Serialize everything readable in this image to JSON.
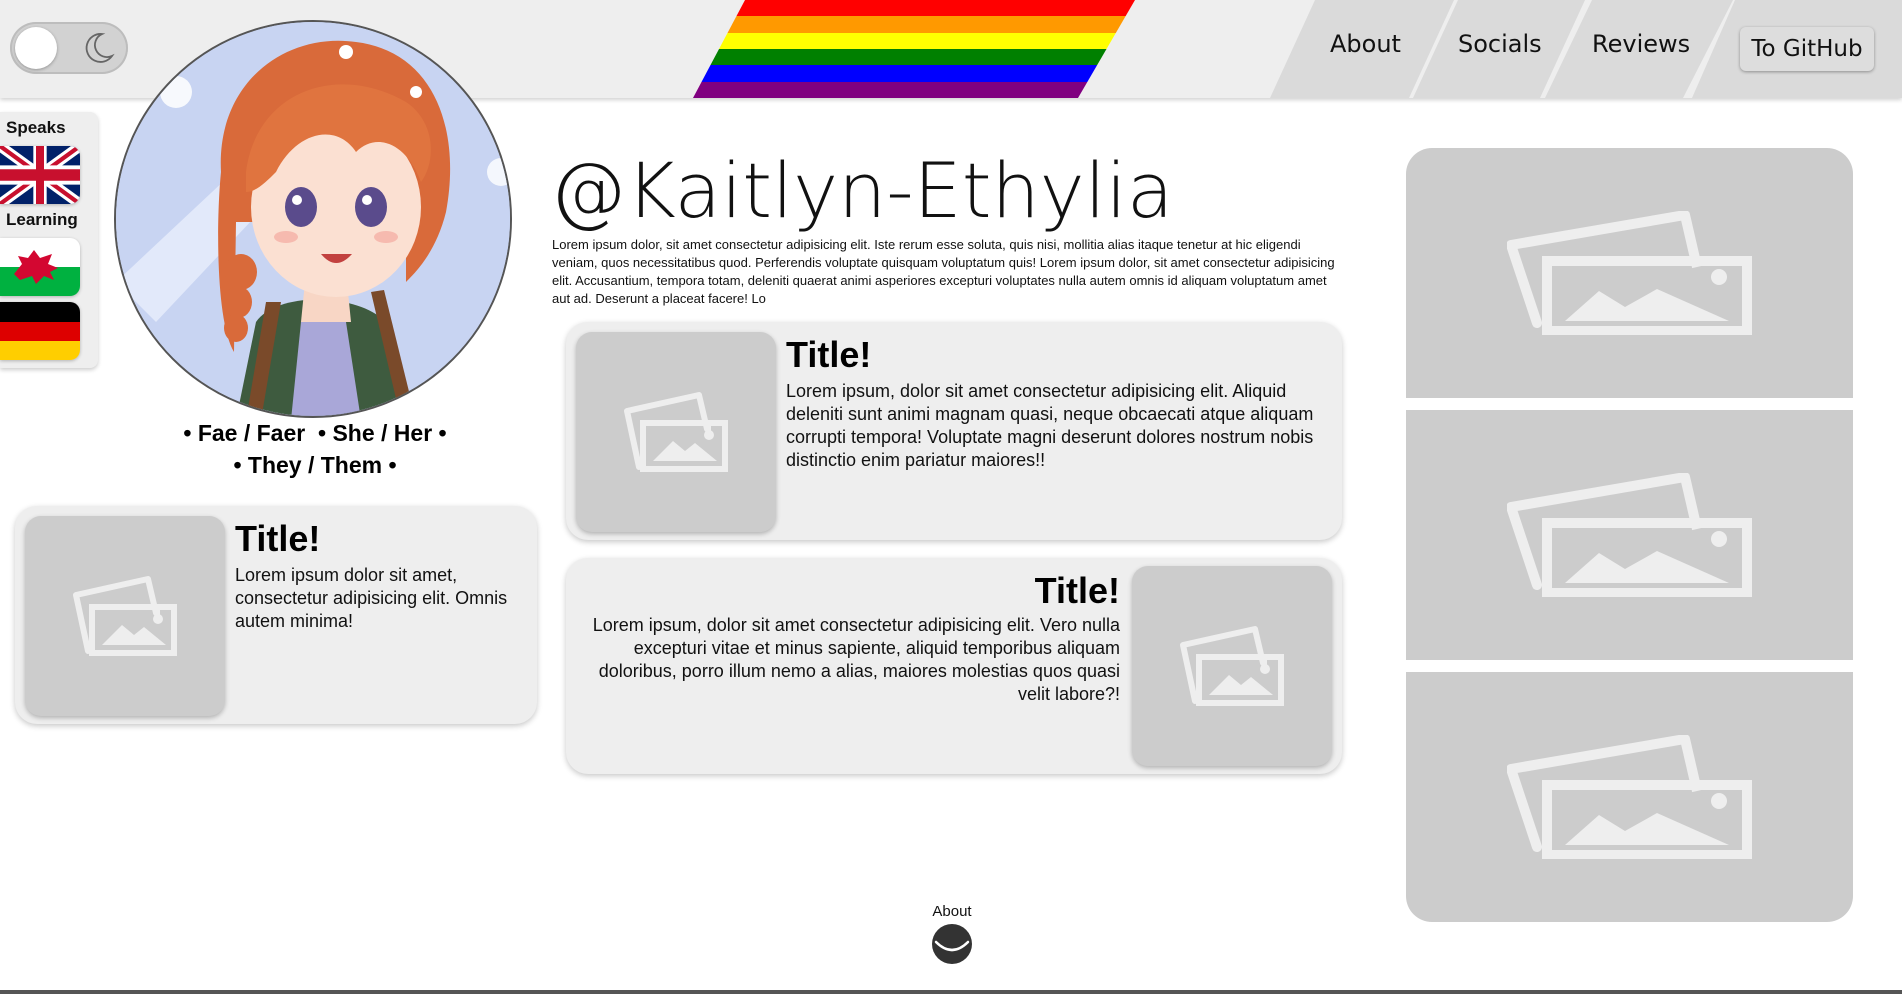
{
  "header": {
    "theme_toggle": {
      "state": "light",
      "icon": "moon-icon"
    },
    "pride_banner": {
      "colors": [
        "#ff0000",
        "#ff9900",
        "#ffff00",
        "#008000",
        "#0000ff",
        "#800080"
      ]
    },
    "nav": [
      {
        "label": "About"
      },
      {
        "label": "Socials"
      },
      {
        "label": "Reviews"
      }
    ],
    "github_button": "To GitHub"
  },
  "languages": {
    "speaks_label": "Speaks",
    "speaks": [
      {
        "flag": "uk-flag-icon"
      }
    ],
    "learning_label": "Learning",
    "learning": [
      {
        "flag": "wales-flag-icon"
      },
      {
        "flag": "germany-flag-icon"
      }
    ]
  },
  "profile": {
    "pronouns_line1": "• Fae / Faer  • She / Her •",
    "pronouns_line2": "• They / Them •",
    "username": "@Kaitlyn-Ethylia",
    "bio": "Lorem ipsum dolor, sit amet consectetur adipisicing elit. Iste rerum esse soluta, quis nisi, mollitia alias itaque tenetur at hic eligendi veniam, quos necessitatibus quod. Perferendis voluptate quisquam voluptatum quis! Lorem ipsum dolor, sit amet consectetur adipisicing elit. Accusantium, tempora totam, deleniti quaerat animi asperiores excepturi voluptates nulla autem omnis id aliquam voluptatum amet aut ad. Deserunt a placeat facere! Lo"
  },
  "cards": [
    {
      "title": "Title!",
      "text": "Lorem ipsum dolor sit amet, consectetur adipisicing elit. Omnis autem minima!"
    },
    {
      "title": "Title!",
      "text": "Lorem ipsum, dolor sit amet consectetur adipisicing elit. Aliquid deleniti sunt animi magnam quasi, neque obcaecati atque aliquam corrupti tempora! Voluptate magni deserunt dolores nostrum nobis distinctio enim pariatur maiores!!"
    },
    {
      "title": "Title!",
      "text": "Lorem ipsum, dolor sit amet consectetur adipisicing elit. Vero nulla excepturi vitae et minus sapiente, aliquid temporibus aliquam doloribus, porro illum nemo a alias, maiores molestias quos quasi velit labore?!"
    }
  ],
  "gallery": [
    {
      "icon": "image-placeholder-icon"
    },
    {
      "icon": "image-placeholder-icon"
    },
    {
      "icon": "image-placeholder-icon"
    }
  ],
  "footer": {
    "about_label": "About",
    "scroll_icon": "chevron-down-icon"
  }
}
